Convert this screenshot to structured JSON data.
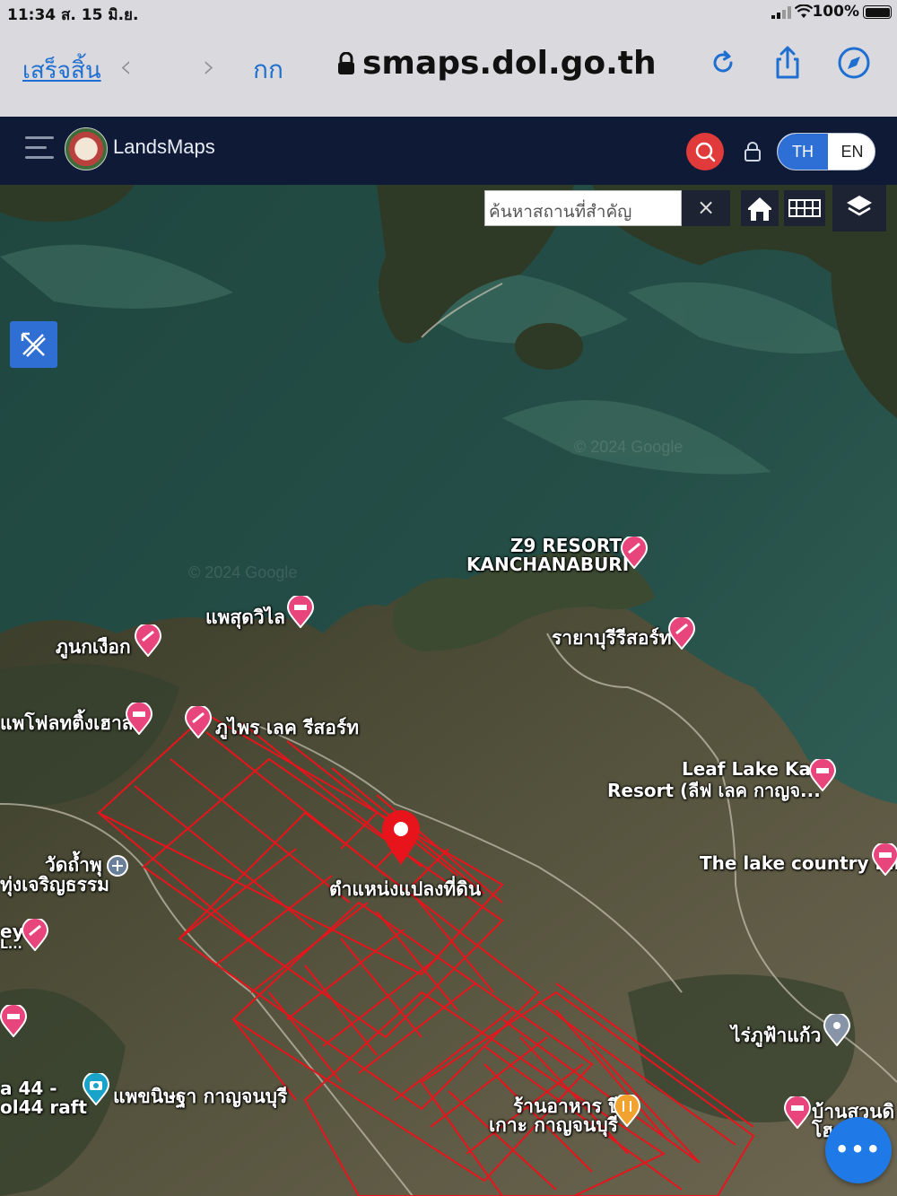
{
  "status_bar": {
    "time": "11:34 ส. 15 มิ.ย.",
    "battery": "100%"
  },
  "browser": {
    "done_label": "เสร็จสิ้น",
    "text_size_label": "กก",
    "url": "smaps.dol.go.th",
    "icons": [
      "back-icon",
      "forward-icon",
      "lock-icon",
      "reload-icon",
      "share-icon",
      "compass-icon"
    ]
  },
  "app": {
    "brand": "LandsMaps",
    "lang": {
      "th": "TH",
      "en": "EN",
      "active": "TH"
    },
    "accent": "#2e6fd6",
    "header_bg": "#0e1a36"
  },
  "map": {
    "search_placeholder": "ค้นหาสถานที่สำคัญ",
    "clear_label": "×",
    "watermarks": [
      "© 2024 Google",
      "© 2024 Google"
    ],
    "labels": {
      "z9_line1": "Z9 RESORT",
      "z9_line2": "KANCHANABURI",
      "phae_sudwilai": "แพสุดวิไล",
      "phu_nok_ngueak": "ภูนกเงือก",
      "rayaburi": "รายาบุรีรีสอร์ท",
      "phae_float": "แพโฟลทติ้งเฮาส์",
      "phuphrai": "ภูไพร เลค รีสอร์ท",
      "leaf_line1": "Leaf Lake Kan",
      "leaf_line2": "Resort (ลีฟ เลค กาญจ...",
      "lake_country": "The lake country hill",
      "wat_line1": "วัดถ้ำพุ",
      "wat_line2": "ทุ่งเจริญธรรม",
      "parcel": "ตำแหน่งแปลงที่ดิน",
      "edge_ey": "ey",
      "edge_l": "L...",
      "edge_44a": "a 44 -",
      "edge_44b": "ol44 raft",
      "phae_nintha": "แพขนิษฐา กาญจนบุรี",
      "rai_phufa": "ไร่ภูฟ้าแก้ว",
      "restaurant_line1": "ร้านอาหาร ปี",
      "restaurant_line2": "เกาะ กาญจนบุรี",
      "ban_line1": "บ้านสวนดิ",
      "ban_line2": "โฮ"
    },
    "parcel_color": "#e8141c",
    "marker_color": "#e8141c",
    "poi_color": "#e9457d"
  },
  "fab_label": "•••"
}
